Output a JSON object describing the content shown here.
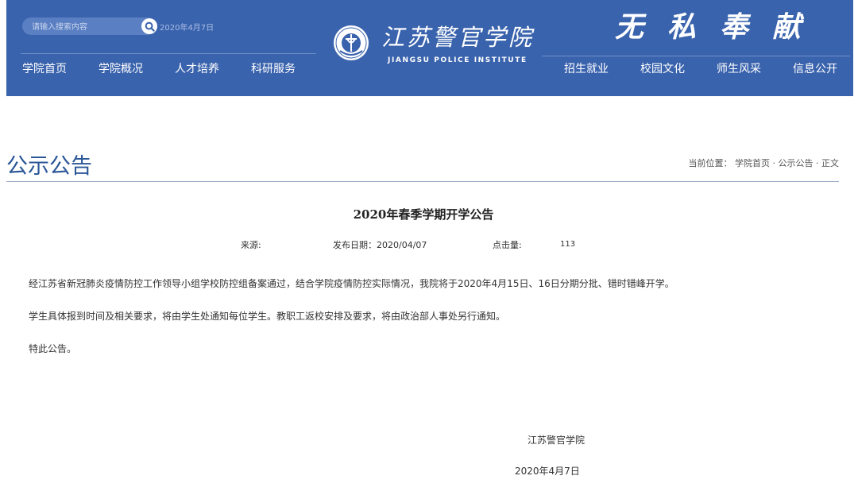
{
  "header": {
    "search": {
      "placeholder": "请输入搜索内容",
      "icon": "search-icon"
    },
    "date": "2020年4月7日",
    "nav_left": [
      "学院首页",
      "学院概况",
      "人才培养",
      "科研服务"
    ],
    "nav_right": [
      "招生就业",
      "校园文化",
      "师生风采",
      "信息公开"
    ],
    "logo": {
      "cn": "江苏警官学院",
      "en": "JIANGSU POLICE INSTITUTE"
    },
    "slogan": [
      "无",
      "私",
      "奉",
      "献"
    ],
    "bg_color": "#3a63ad"
  },
  "section": {
    "title": "公示公告",
    "breadcrumb": {
      "prefix": "当前位置：",
      "home": "学院首页",
      "sep1": "·",
      "category": "公示公告",
      "sep2": "·",
      "current": "正文"
    }
  },
  "article": {
    "title": "2020年春季学期开学公告",
    "meta": {
      "source_label": "来源:",
      "date_label": "发布日期：",
      "date": "2020/04/07",
      "views_label": "点击量:",
      "views": "113"
    },
    "paragraphs": [
      "经江苏省新冠肺炎疫情防控工作领导小组学校防控组备案通过，结合学院疫情防控实际情况，我院将于2020年4月15日、16日分期分批、错时错峰开学。",
      "学生具体报到时间及相关要求，将由学生处通知每位学生。教职工返校安排及要求，将由政治部人事处另行通知。",
      "特此公告。"
    ],
    "signature": "江苏警官学院",
    "sign_date": "2020年4月7日"
  }
}
